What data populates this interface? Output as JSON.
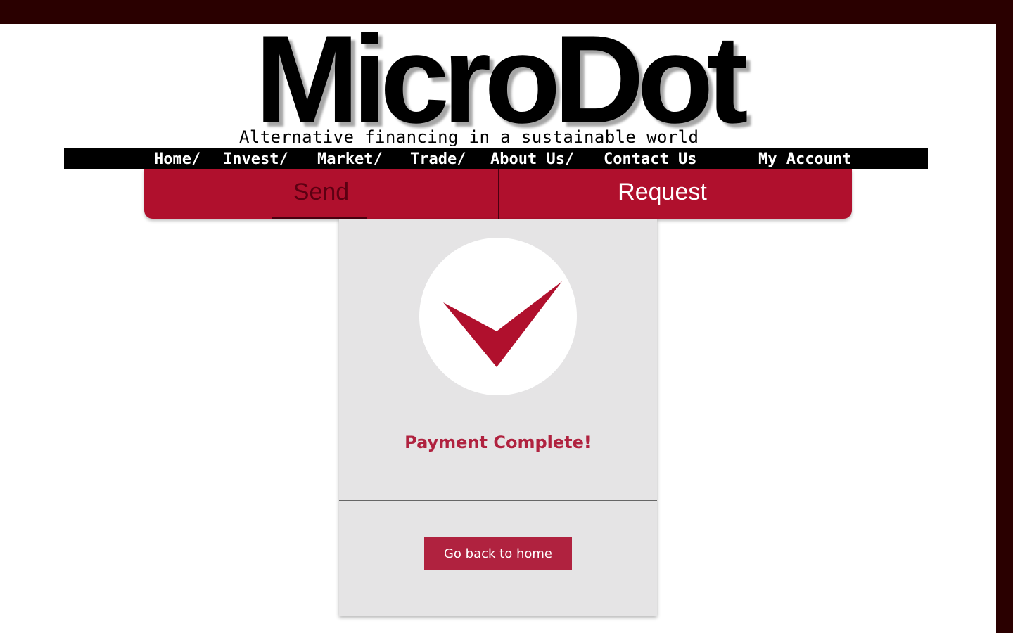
{
  "brand": {
    "logo_part1": "MicroD",
    "logo_part2": "ot",
    "logo_text": "MicroDot",
    "tagline": "Alternative financing in a sustainable world"
  },
  "nav": {
    "home": "Home/",
    "invest": "Invest/",
    "market": "Market/",
    "trade": "Trade/",
    "about": "About Us/",
    "contact": "Contact Us",
    "account": "My Account"
  },
  "tabs": {
    "send": "Send",
    "request": "Request",
    "active": "send"
  },
  "card": {
    "icon": "checkmark-icon",
    "status": "Payment Complete!",
    "button": "Go back to home"
  },
  "colors": {
    "accent": "#b0102d",
    "text_accent": "#b0223f",
    "frame": "#2a0000",
    "card_bg": "#e5e4e5"
  }
}
